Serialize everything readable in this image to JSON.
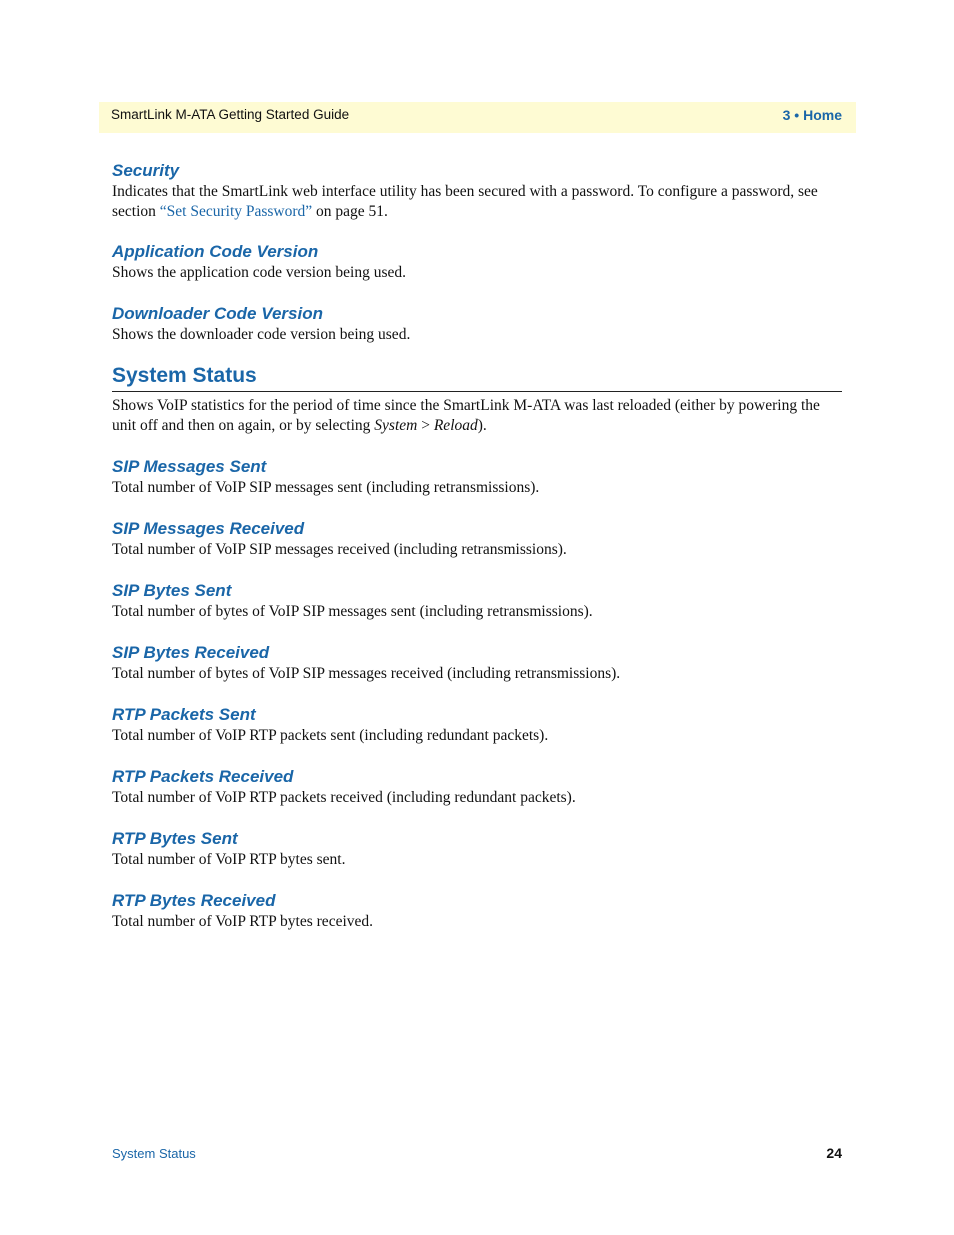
{
  "header": {
    "title": "SmartLink M-ATA Getting Started Guide",
    "chapter": "3 • Home"
  },
  "sections": {
    "security": {
      "title": "Security",
      "text_before": "Indicates that the SmartLink web interface utility has been secured with a password. To configure a password, see section ",
      "link": "“Set Security Password”",
      "text_after": " on page 51."
    },
    "app_code": {
      "title": "Application Code Version",
      "text": "Shows the application code version being used."
    },
    "downloader": {
      "title": "Downloader Code Version",
      "text": "Shows the downloader code version being used."
    }
  },
  "system_status": {
    "title": "System Status",
    "intro_before": "Shows VoIP statistics for the period of time since the SmartLink M-ATA was last reloaded (either by powering the unit off and then on again, or by selecting ",
    "intro_menu1": "System",
    "intro_sep": " > ",
    "intro_menu2": "Reload",
    "intro_after": ")."
  },
  "items": [
    {
      "title": "SIP Messages Sent",
      "text": "Total number of VoIP SIP messages sent (including retransmissions)."
    },
    {
      "title": "SIP Messages Received",
      "text": "Total number of VoIP SIP messages received (including retransmissions)."
    },
    {
      "title": "SIP Bytes Sent",
      "text": "Total number of bytes of VoIP SIP messages sent (including retransmissions)."
    },
    {
      "title": "SIP Bytes Received",
      "text": "Total number of bytes of VoIP SIP messages received (including retransmissions)."
    },
    {
      "title": "RTP Packets Sent",
      "text": "Total number of VoIP RTP packets sent (including redundant packets)."
    },
    {
      "title": "RTP Packets Received",
      "text": "Total number of VoIP RTP packets received (including redundant packets)."
    },
    {
      "title": "RTP Bytes Sent",
      "text": "Total number of VoIP RTP bytes sent."
    },
    {
      "title": "RTP Bytes Received",
      "text": "Total number of VoIP RTP bytes received."
    }
  ],
  "footer": {
    "section": "System Status",
    "page": "24"
  }
}
